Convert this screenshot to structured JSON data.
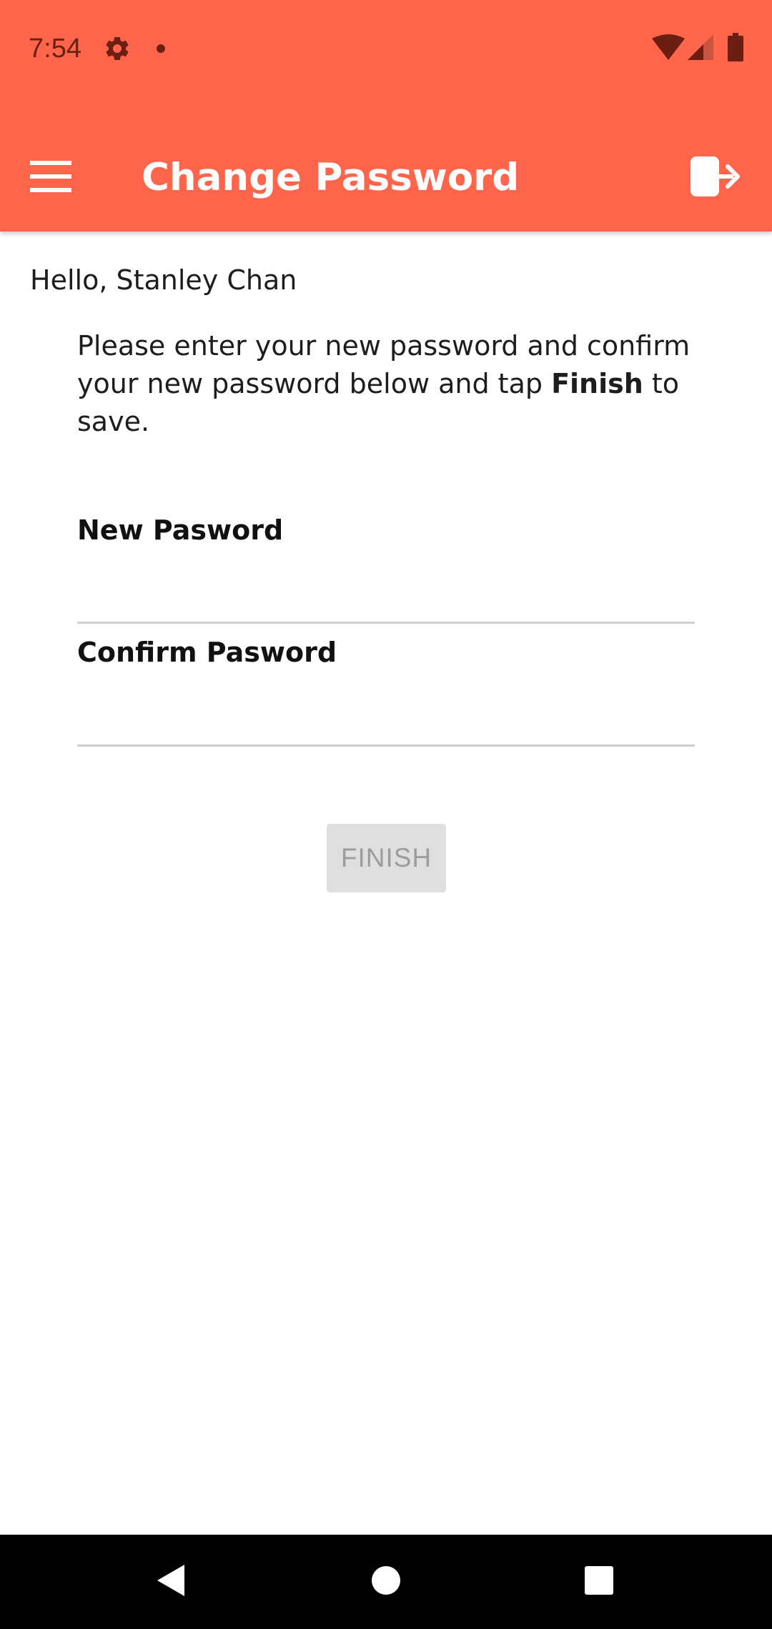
{
  "status_bar": {
    "time": "7:54",
    "icons": [
      "settings-icon",
      "notification-dot-icon",
      "wifi-icon",
      "cell-signal-icon",
      "battery-icon"
    ]
  },
  "toolbar": {
    "title": "Change Password",
    "menu_icon": "hamburger-menu-icon",
    "logout_icon": "logout-icon",
    "background_color": "#FF654B"
  },
  "content": {
    "greeting": "Hello, Stanley Chan",
    "instructions_before": "Please enter your new password and confirm your new password below and tap ",
    "instructions_bold": "Finish",
    "instructions_after": " to save.",
    "new_password_label": "New Pasword",
    "new_password_value": "",
    "confirm_password_label": "Confirm Pasword",
    "confirm_password_value": "",
    "finish_button_label": "FINISH"
  },
  "nav_bar": {
    "icons": [
      "back-icon",
      "home-icon",
      "recents-icon"
    ]
  }
}
